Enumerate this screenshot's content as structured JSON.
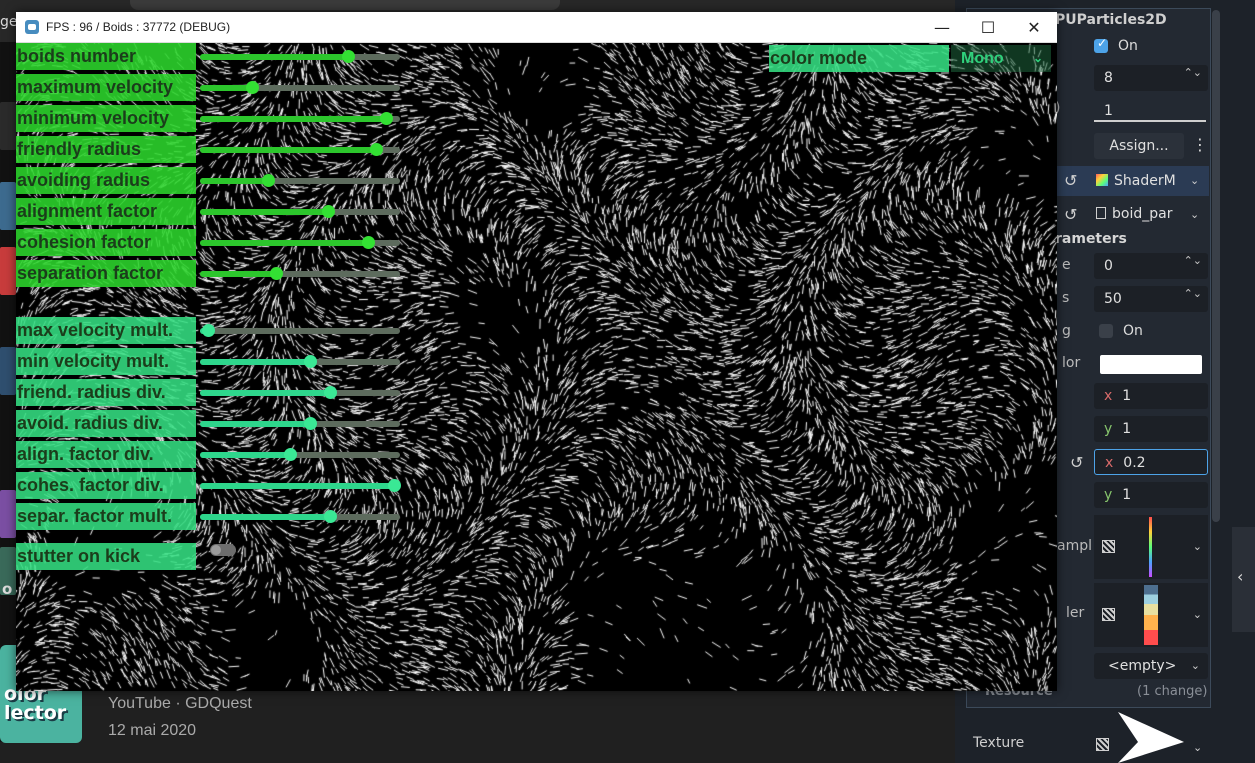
{
  "window": {
    "title": "FPS : 96 /  Boids : 37772 (DEBUG)",
    "minimize": "—",
    "maximize": "☐",
    "close": "✕"
  },
  "sliders": [
    {
      "label": "boids number",
      "value": 0.74,
      "style": "g"
    },
    {
      "label": "maximum velocity",
      "value": 0.26,
      "style": "g"
    },
    {
      "label": "minimum velocity",
      "value": 0.93,
      "style": "g"
    },
    {
      "label": "friendly radius",
      "value": 0.88,
      "style": "g"
    },
    {
      "label": "avoiding radius",
      "value": 0.34,
      "style": "g"
    },
    {
      "label": "alignment factor",
      "value": 0.64,
      "style": "g"
    },
    {
      "label": "cohesion factor",
      "value": 0.84,
      "style": "g"
    },
    {
      "label": "separation factor",
      "value": 0.38,
      "style": "g"
    },
    {
      "label": "max velocity mult.",
      "value": 0.04,
      "style": "t"
    },
    {
      "label": "min velocity mult.",
      "value": 0.55,
      "style": "t"
    },
    {
      "label": "friend. radius div.",
      "value": 0.65,
      "style": "t"
    },
    {
      "label": "avoid. radius div.",
      "value": 0.55,
      "style": "t"
    },
    {
      "label": "align. factor div.",
      "value": 0.45,
      "style": "t"
    },
    {
      "label": "cohes. factor div.",
      "value": 0.97,
      "style": "t"
    },
    {
      "label": "separ. factor mult.",
      "value": 0.65,
      "style": "t"
    }
  ],
  "stutter": {
    "label": "stutter on kick",
    "on": false
  },
  "color_mode": {
    "label": "color mode",
    "value": "Mono",
    "chevron": "⌄"
  },
  "inspector": {
    "node_title": "PUParticles2D",
    "emitting_value": "On",
    "amount_value": "8",
    "spin_glyph": "⌃⌄",
    "ratio_value": "1",
    "assign_button": "Assign...",
    "more_glyph": "⋮",
    "material_name": "ShaderM",
    "shader_name": "boid_par",
    "section_header": "rameters",
    "param_a_label": "e",
    "param_a_value": "0",
    "param_b_label": "s",
    "param_b_value": "50",
    "flag_label": "g",
    "flag_value": "On",
    "color_label": "lor",
    "vec1_x": "1",
    "vec1_y": "1",
    "vec2_x": "0.2",
    "vec2_y": "1",
    "x_glyph": "x",
    "y_glyph": "y",
    "sampler_a_label": "ampl",
    "sampler_b_label": "ler",
    "empty_value": "<empty>",
    "resource_label": "Resource",
    "resource_changes": "(1 change)",
    "texture_label": "Texture",
    "revert_glyph": "↺",
    "chevron_glyph": "⌄"
  },
  "background": {
    "video_source": "YouTube · GDQuest",
    "video_date": "12 mai 2020",
    "thumb_line1": "olor",
    "thumb_line2": "lector",
    "cut_text_1": "o t",
    "cut_text_2": "ge"
  },
  "colors": {
    "accent_green": "#2cc62c",
    "accent_teal": "#2ed68c",
    "inspector_bg": "#1d2229",
    "godot_blue": "#478cbf"
  }
}
